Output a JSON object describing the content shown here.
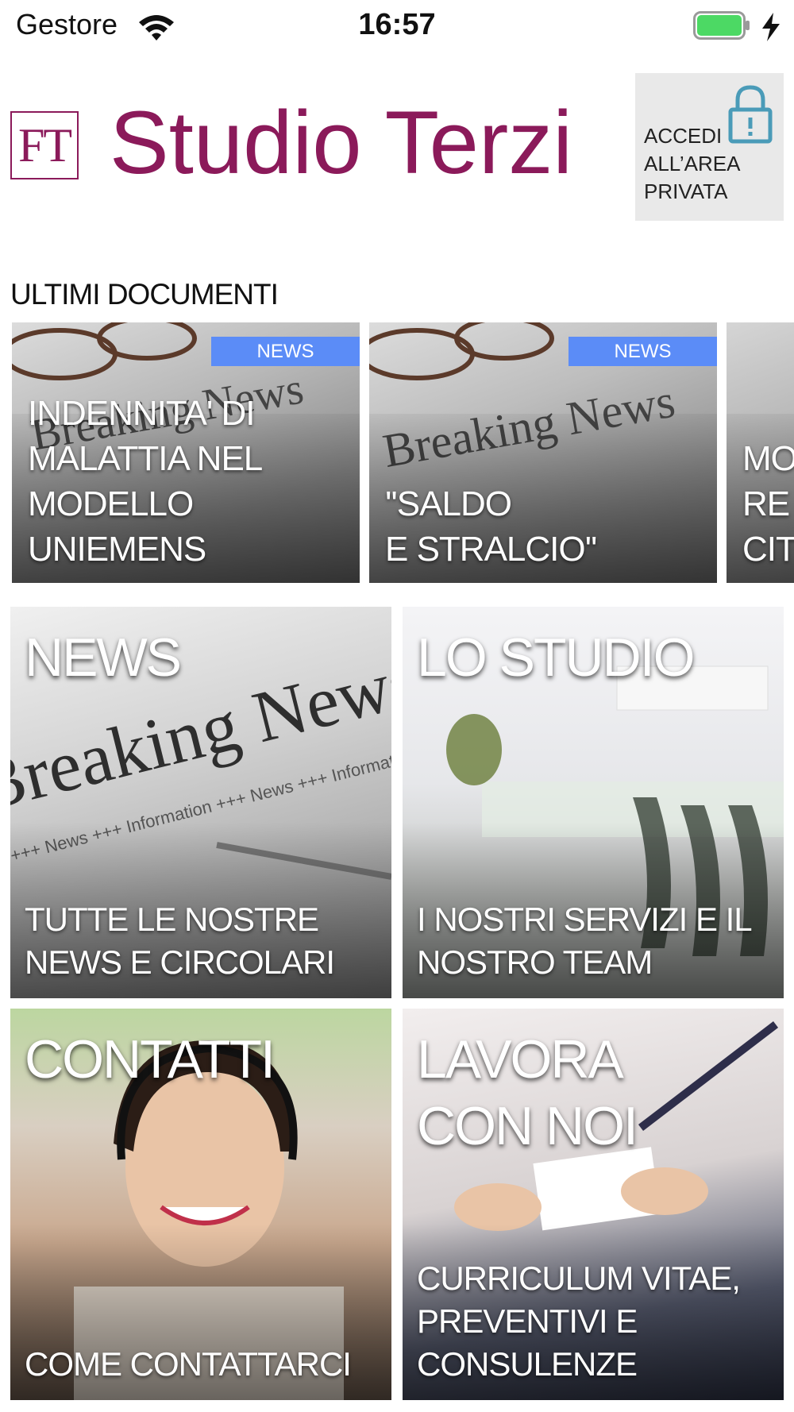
{
  "status_bar": {
    "carrier": "Gestore",
    "time": "16:57",
    "battery_color": "#4cd964"
  },
  "header": {
    "logo_initials": "FT",
    "brand_name": "Studio Terzi",
    "brand_color": "#8b1a5a",
    "login_label": "ACCEDI ALL’AREA PRIVATA",
    "login_lines": [
      "ACCEDI",
      "ALL’AREA",
      "PRIVATA"
    ],
    "login_icon": "lock-icon"
  },
  "latest_documents": {
    "title": "ULTIMI DOCUMENTI",
    "items": [
      {
        "badge": "NEWS",
        "title": "INDENNITA' DI\nMALATTIA NEL\nMODELLO UNIEMENS"
      },
      {
        "badge": "NEWS",
        "title": "''SALDO\nE STRALCIO''"
      },
      {
        "badge": "",
        "title": "MO\nRE\nCIT"
      }
    ],
    "badge_color": "#5b8cf7"
  },
  "tiles": [
    {
      "title": "NEWS",
      "subtitle": "TUTTE LE NOSTRE NEWS E CIRCOLARI"
    },
    {
      "title": "LO STUDIO",
      "subtitle": "I NOSTRI SERVIZI E IL NOSTRO TEAM"
    },
    {
      "title": "CONTATTI",
      "subtitle": "COME CONTATTARCI"
    },
    {
      "title": "LAVORA\nCON NOI",
      "subtitle": "CURRICULUM VITAE, PREVENTIVI E CONSULENZE"
    }
  ]
}
